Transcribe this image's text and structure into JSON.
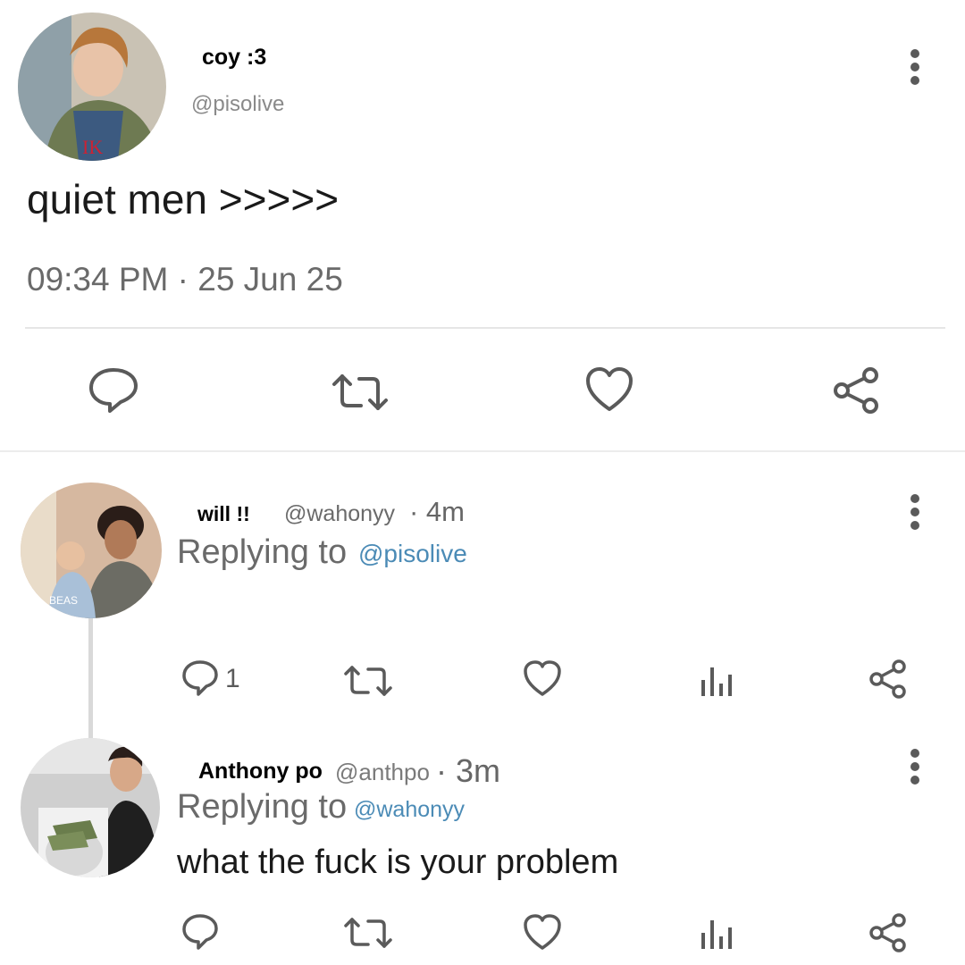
{
  "main_tweet": {
    "display_name": "coy :3",
    "handle": "@pisolive",
    "text": "quiet men >>>>>",
    "timestamp": "09:34 PM · 25 Jun 25",
    "actions": [
      "reply-icon",
      "retweet-icon",
      "like-icon",
      "share-icon"
    ]
  },
  "replies": [
    {
      "display_name": "will !!",
      "handle": "@wahonyy",
      "time": "· 4m",
      "replying_prefix": "Replying to",
      "replying_to": "@pisolive",
      "text": "",
      "reply_count": "1",
      "actions": [
        "reply-icon",
        "retweet-icon",
        "like-icon",
        "analytics-icon",
        "share-icon"
      ]
    },
    {
      "display_name": "Anthony po",
      "handle": "@anthpo",
      "time": "· 3m",
      "replying_prefix": "Replying to",
      "replying_to": "@wahonyy",
      "text": "what the fuck is your problem",
      "actions": [
        "reply-icon",
        "retweet-icon",
        "like-icon",
        "analytics-icon",
        "share-icon"
      ]
    }
  ],
  "colors": {
    "link": "#4b8bb6",
    "icon": "#5a5a5a",
    "handle": "#8a8a8a"
  }
}
